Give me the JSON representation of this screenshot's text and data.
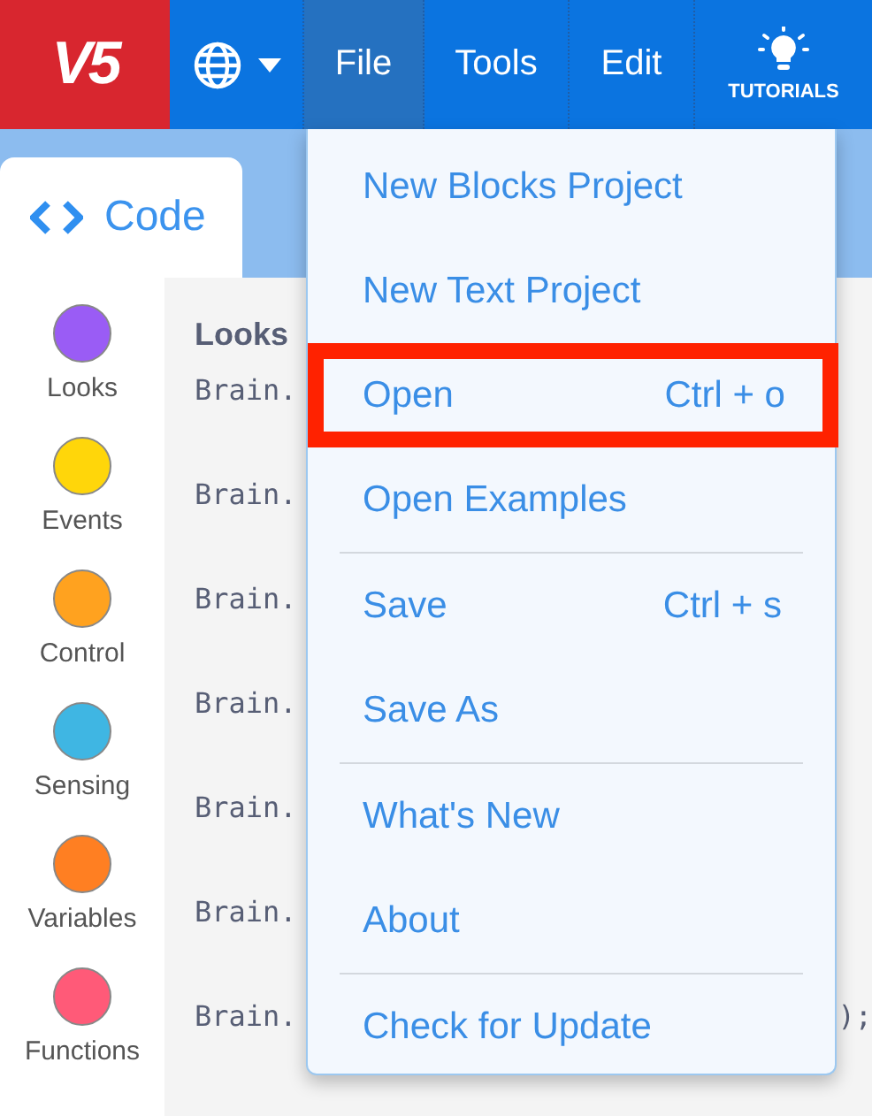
{
  "nav": [
    {
      "kind": "logo",
      "label": "V5",
      "selected": false
    },
    {
      "kind": "language",
      "selected": false
    },
    {
      "kind": "menu",
      "label": "File",
      "selected": true
    },
    {
      "kind": "menu",
      "label": "Tools",
      "selected": false
    },
    {
      "kind": "menu",
      "label": "Edit",
      "selected": false
    },
    {
      "kind": "tutorials",
      "label": "TUTORIALS",
      "selected": false
    }
  ],
  "tab": {
    "label": "Code"
  },
  "categories": [
    {
      "label": "Looks",
      "color": "#9a5cf5"
    },
    {
      "label": "Events",
      "color": "#ffd60a"
    },
    {
      "label": "Control",
      "color": "#ffa21f"
    },
    {
      "label": "Sensing",
      "color": "#3fb6e3"
    },
    {
      "label": "Variables",
      "color": "#ff7f22"
    },
    {
      "label": "Functions",
      "color": "#ff5a78"
    }
  ],
  "code": {
    "heading": "Looks",
    "lines": [
      {
        "text": "Brain."
      },
      {
        "text": "Brain."
      },
      {
        "text": "Brain."
      },
      {
        "text": "Brain."
      },
      {
        "text": "Brain."
      },
      {
        "text": "Brain."
      },
      {
        "text": "Brain.",
        "tail": ");"
      }
    ]
  },
  "file_menu": [
    {
      "label": "New Blocks Project",
      "highlighted": false,
      "divider_after": false
    },
    {
      "label": "New Text Project",
      "highlighted": false,
      "divider_after": false
    },
    {
      "label": "Open",
      "shortcut": "Ctrl + o",
      "highlighted": true,
      "divider_after": false
    },
    {
      "label": "Open Examples",
      "highlighted": false,
      "divider_after": true
    },
    {
      "label": "Save",
      "shortcut": "Ctrl + s",
      "highlighted": false,
      "divider_after": false
    },
    {
      "label": "Save As",
      "highlighted": false,
      "divider_after": true
    },
    {
      "label": "What's New",
      "highlighted": false,
      "divider_after": false
    },
    {
      "label": "About",
      "highlighted": false,
      "divider_after": true
    },
    {
      "label": "Check for Update",
      "highlighted": false,
      "divider_after": false
    }
  ]
}
